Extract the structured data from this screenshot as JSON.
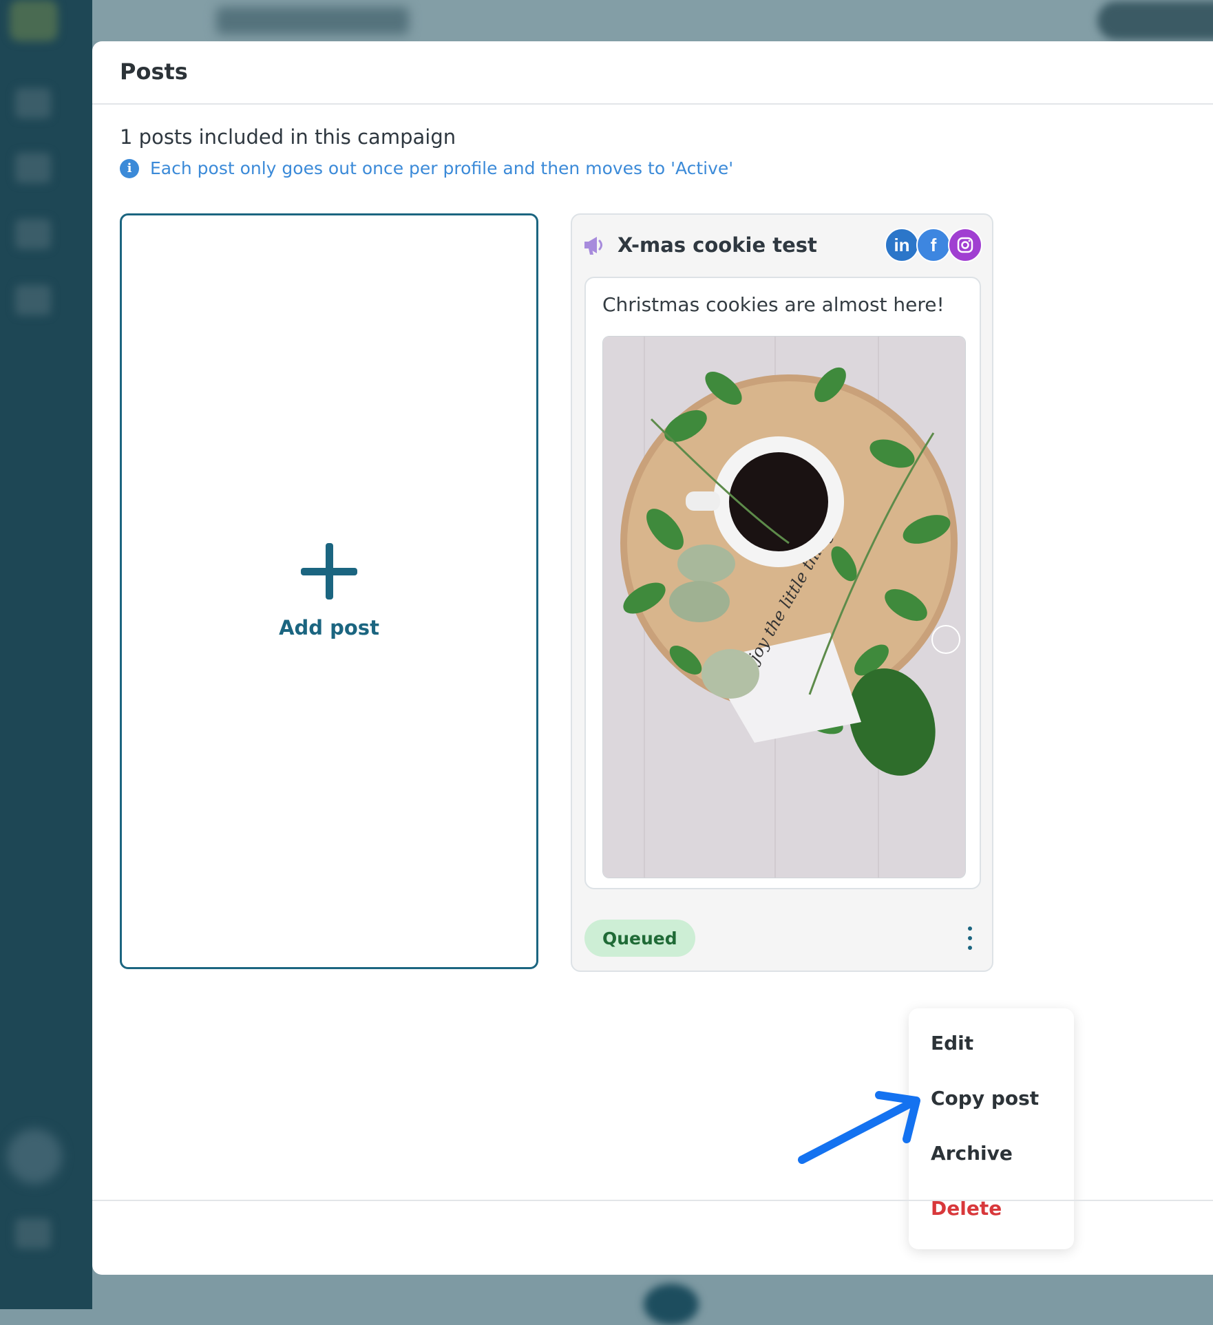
{
  "modal": {
    "title": "Posts",
    "count_text": "1 posts included in this campaign",
    "info_text": "Each post only goes out once per profile and then moves to 'Active'"
  },
  "add_card": {
    "label": "Add post"
  },
  "post": {
    "title": "X-mas cookie test",
    "text": "Christmas cookies are almost here!",
    "image_note_text": "enjoy the little things",
    "status": "Queued",
    "networks": [
      "linkedin",
      "facebook",
      "instagram"
    ]
  },
  "menu": {
    "items": [
      {
        "label": "Edit",
        "style": "normal"
      },
      {
        "label": "Copy post",
        "style": "normal"
      },
      {
        "label": "Archive",
        "style": "normal"
      },
      {
        "label": "Delete",
        "style": "danger"
      }
    ]
  },
  "colors": {
    "accent": "#1b6580",
    "info_blue": "#3b8ad8",
    "queued_bg": "#cdeed5",
    "queued_text": "#1f6a36",
    "delete_red": "#d8383b",
    "arrow_blue": "#1472f0"
  },
  "icons": {
    "info": "info-circle-icon",
    "campaign": "megaphone-icon",
    "add": "plus-icon",
    "more": "kebab-menu-icon"
  }
}
